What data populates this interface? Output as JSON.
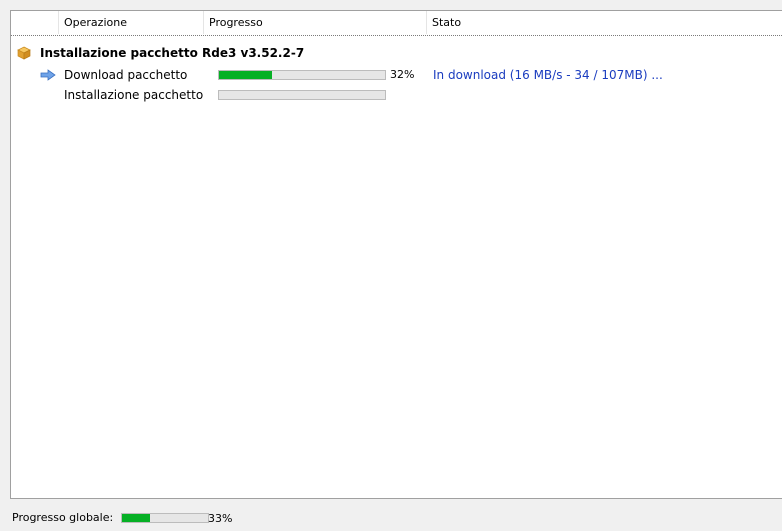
{
  "columns": {
    "operation": "Operazione",
    "progress": "Progresso",
    "status": "Stato"
  },
  "group": {
    "title": "Installazione pacchetto Rde3 v3.52.2-7",
    "icon": "package-icon"
  },
  "tasks": [
    {
      "label": "Download pacchetto",
      "icon": "arrow-right-icon",
      "progress": 0.32,
      "percent_text": "32%",
      "status": "In download (16 MB/s - 34 / 107MB) ..."
    },
    {
      "label": "Installazione pacchetto",
      "progress": 0,
      "percent_text": "",
      "status": ""
    }
  ],
  "footer": {
    "label": "Progresso globale:",
    "progress": 0.33,
    "percent_text": "33%"
  },
  "colors": {
    "progress_fill": "#06b025",
    "status_text": "#1a3cbf"
  }
}
